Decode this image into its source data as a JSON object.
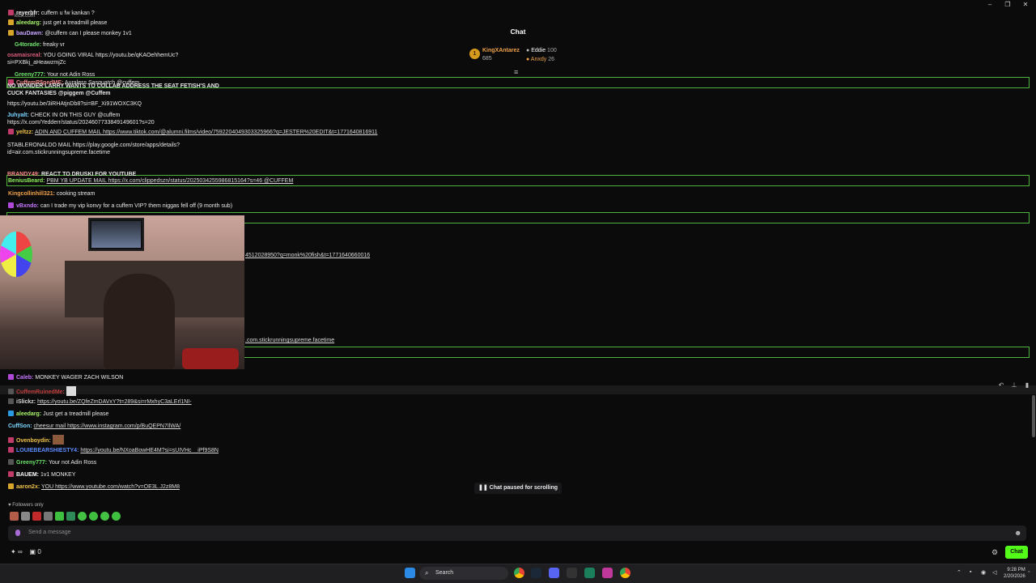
{
  "window": {
    "url": "kick.com",
    "minimize": "–",
    "restore": "❐",
    "close": "✕"
  },
  "header": {
    "title": "Chat",
    "top_gifter": {
      "name": "KingXAntarez",
      "count": "685",
      "rank": "1"
    },
    "gifters": [
      {
        "name": "Eddie",
        "count": "100"
      },
      {
        "name": "Anxdy",
        "count": "26"
      }
    ]
  },
  "overlay_messages": [
    {
      "user": "reyerbfr:",
      "text": "cuffem u fw kankan ?",
      "color": "#f1f1f1"
    },
    {
      "user": "aleedarg:",
      "text": "just get a treadmill please",
      "color": "#a7f26a"
    },
    {
      "user": "bauDawn:",
      "text": "@cuffem can I please monkey 1v1",
      "color": "#c7a6ff"
    },
    {
      "user": "G4torade:",
      "text": "freaky vr",
      "color": "#6ee26b"
    },
    {
      "user": "osamaisreal:",
      "text": "YOU GOING VIRAL https://youtu.be/qKAOehhemUc?si=PXBkj_aHeawzmjZc",
      "color": "#d85b7a"
    },
    {
      "user": "Greeny777:",
      "text": "Your not Adin Ross",
      "color": "#6ee26b"
    },
    {
      "user": "CuffemR$pedME:",
      "text": "Auraless Sasquatch @cuffem",
      "color": "#f28b8b"
    },
    {
      "user": "",
      "text": "NO WONDER LARRY WANTS TO COLLAB ADDRESS THE SEAT FETISH'S AND CUCK FANTASIES @piggem @Cuffem",
      "color": "#ffffff"
    },
    {
      "user": "",
      "text": "https://youtu.be/3iRHAtjnDb8?si=BF_Xi91WOXC3KQ",
      "color": "#ffffff"
    },
    {
      "user": "Juhyalt:",
      "text": "CHECK IN ON THIS GUY @cuffem https://x.com/Yedderr/status/2024607733849149601?s=20",
      "color": "#7bd6ff"
    },
    {
      "user": "yeltzz:",
      "text": "ADIN AND CUFFEM MAIL https://www.tiktok.com/@alumni.films/video/7592204049303325966?q=JESTER%20EDIT&t=1771640816911",
      "color": "#f0c24a"
    },
    {
      "user": "",
      "text": "STABLERONALDO MAIL https://play.google.com/store/apps/details?id=air.com.stickrunningsupreme.facetime",
      "color": "#ffffff"
    },
    {
      "user": "BRANDY49:",
      "text": "REACT TO DRUSKI FOR YOUTUBE",
      "color": "#ff8a8a"
    },
    {
      "user": "BeniusBeard:",
      "text": "PBM YB UPDATE MAIL https://x.com/clippedszn/status/2025034255986815164?s=46 @CUFFEM",
      "color": "#8ef05b"
    },
    {
      "user": "Kingcollinhill321:",
      "text": "cooking stream",
      "color": "#f0a24a"
    },
    {
      "user": "vBxndo:",
      "text": "can I trade my vip konvy for a cuffem VIP? them niggas fell off (9 month sub)",
      "color": "#c779ff"
    },
    {
      "user": "",
      "text": "4512028950?q=monk%20fish&t=1771640660016",
      "color": "#ffffff"
    },
    {
      "user": "",
      "text": ".com.stickrunningsupreme.facetime",
      "color": "#ffffff"
    }
  ],
  "chat_messages": [
    {
      "user": "Caleb:",
      "text": "MONKEY WAGER ZACH WILSON",
      "color": "#c779ff"
    },
    {
      "user": "CuffemRuinedMe:",
      "text": "",
      "color": "#c03a3a"
    },
    {
      "user": "iSlickz:",
      "text": "https://youtu.be/ZQfeZmDAVxY?t=289&si=rMxhyC3aLErl1NI-",
      "color": "#d8d8d8"
    },
    {
      "user": "aleedarg:",
      "text": "Just get a treadmill please",
      "color": "#a7f26a"
    },
    {
      "user": "CuffSon:",
      "text": "cheesur mail https://www.instagram.com/p/BuQEPN7IlWA/",
      "color": "#7bd6ff"
    },
    {
      "user": "Ovenboydin:",
      "text": "",
      "color": "#f0c24a"
    },
    {
      "user": "LOUIEBEARSHIESTY4:",
      "text": "https://youtu.be/NXoaBowHE4M?si=sUIVHc__iPf9S8N",
      "color": "#5b8cff"
    },
    {
      "user": "Greeny777:",
      "text": "Your not Adin Ross",
      "color": "#6ee26b"
    },
    {
      "user": "BAUEM:",
      "text": "1v1 MONKEY",
      "color": "#ffffff"
    },
    {
      "user": "aaron2x:",
      "text": "YOU https://www.youtube.com/watch?v=OE3L.J2z8M8",
      "color": "#f0c24a"
    }
  ],
  "status": {
    "paused": "Chat paused for scrolling",
    "followers_only": "Followers only"
  },
  "composer": {
    "placeholder": "Send a message",
    "chat_button": "Chat",
    "count_left": "∞",
    "count_right": "0"
  },
  "taskbar": {
    "search": "Search",
    "time": "9:28 PM",
    "date": "2/20/2026"
  },
  "colors": {
    "accent": "#53fc18",
    "highlight_border": "#4fb33b"
  }
}
